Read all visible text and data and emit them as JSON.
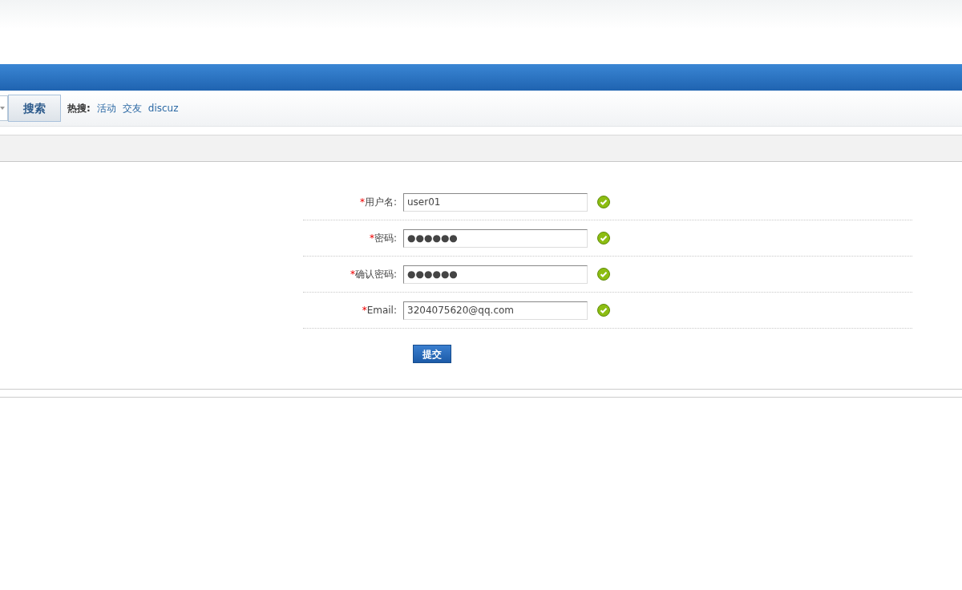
{
  "search_bar": {
    "button": "搜索",
    "hot_label": "热搜:",
    "hot_links": [
      "活动",
      "交友",
      "discuz"
    ]
  },
  "form": {
    "rows": [
      {
        "label": "用户名:",
        "required_mark": "*",
        "required": true,
        "value": "user01",
        "valid": true
      },
      {
        "label": "密码:",
        "required_mark": "*",
        "required": true,
        "value": "●●●●●●",
        "valid": true
      },
      {
        "label": "确认密码:",
        "required_mark": "*",
        "required": true,
        "value": "●●●●●●",
        "valid": true
      },
      {
        "label": "Email:",
        "required_mark": "*",
        "required": true,
        "value": "3204075620@qq.com",
        "valid": true
      }
    ],
    "submit": "提交"
  }
}
